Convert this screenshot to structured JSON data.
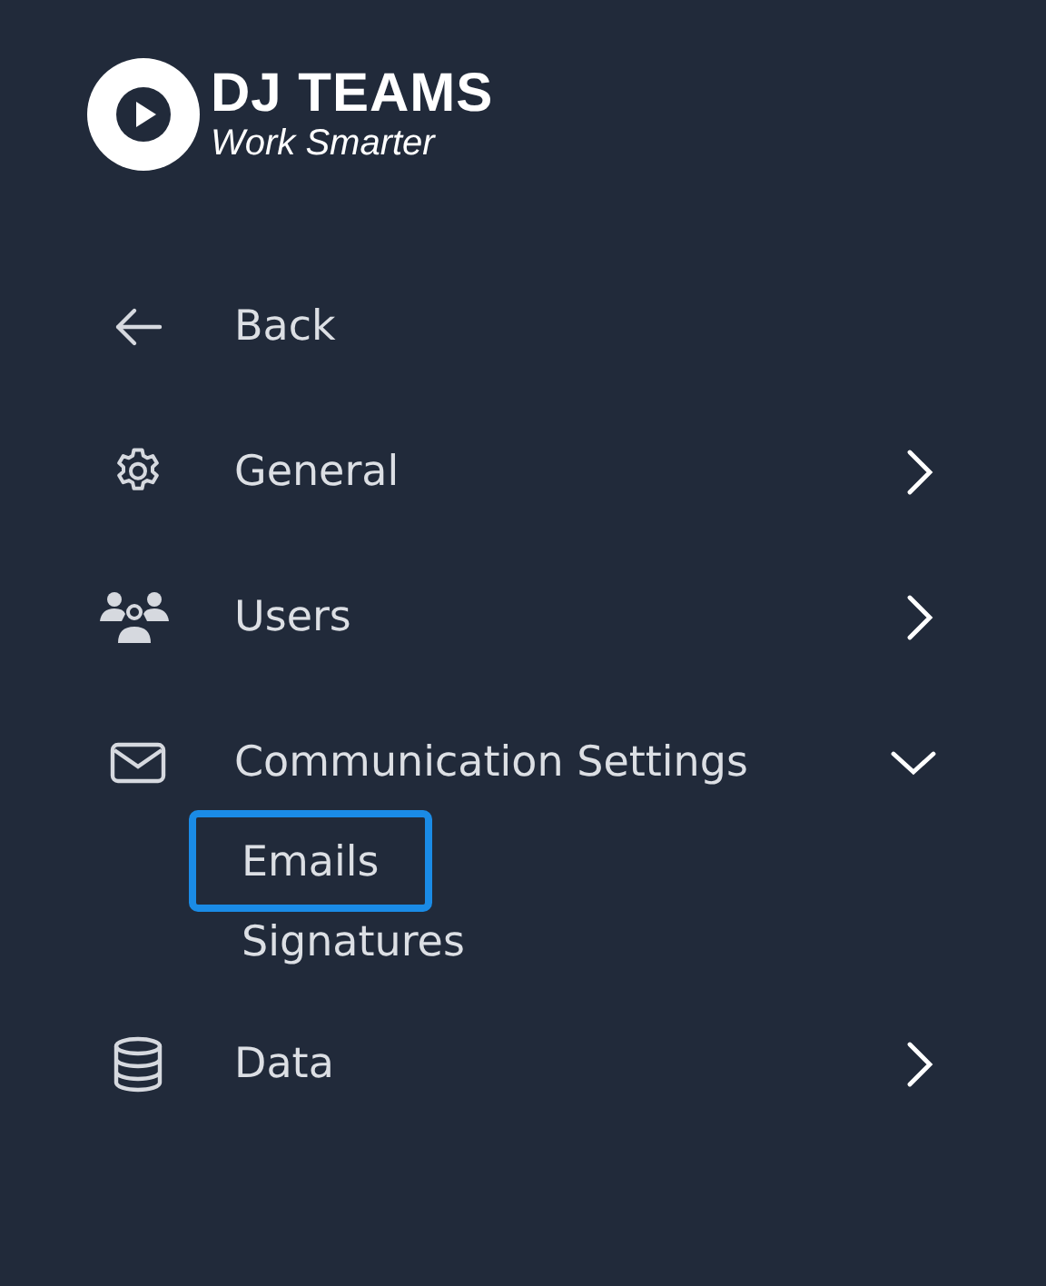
{
  "logo": {
    "title": "DJ TEAMS",
    "tagline": "Work Smarter"
  },
  "menu": [
    {
      "kind": "back",
      "label": "Back"
    },
    {
      "kind": "section",
      "label": "General",
      "expanded": false
    },
    {
      "kind": "section",
      "label": "Users",
      "expanded": false
    },
    {
      "kind": "section",
      "label": "Communication Settings",
      "expanded": true,
      "children": [
        {
          "label": "Emails",
          "selected": true
        },
        {
          "label": "Signatures",
          "selected": false
        }
      ]
    },
    {
      "kind": "section",
      "label": "Data",
      "expanded": false
    }
  ]
}
